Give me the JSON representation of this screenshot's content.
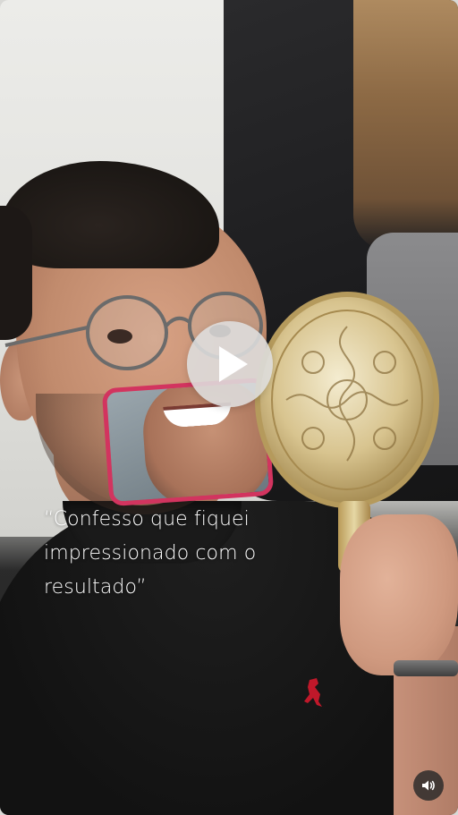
{
  "video": {
    "caption": "“Confesso que fiquei impressionado com o resultado”",
    "play_icon": "play-icon",
    "sound_icon": "speaker-icon",
    "border_accent": "#d2345f"
  }
}
